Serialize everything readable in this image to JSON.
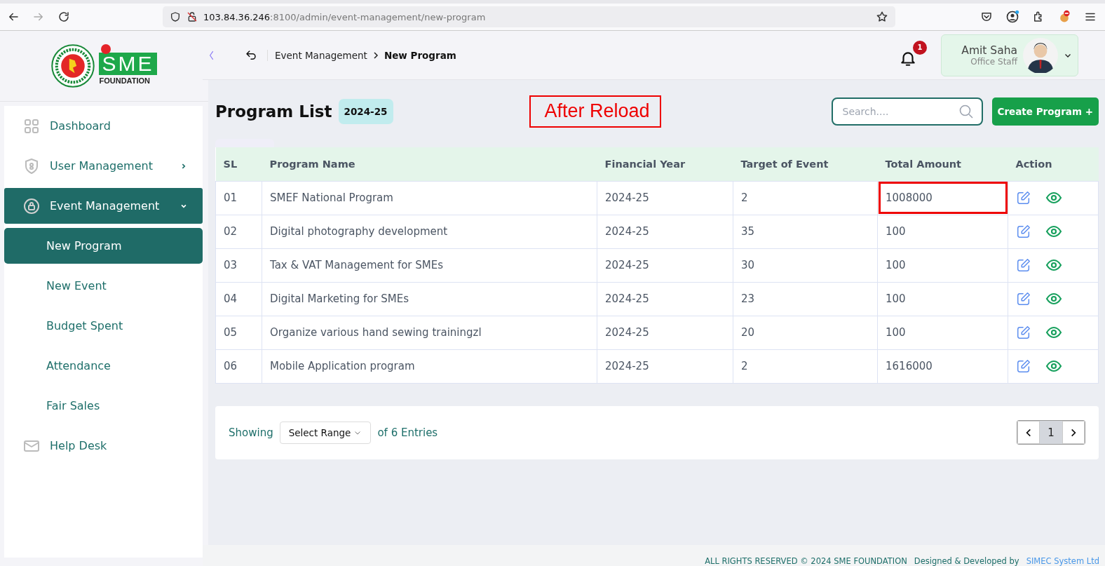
{
  "browser": {
    "url_host": "103.84.36.246",
    "url_rest": ":8100/admin/event-management/new-program"
  },
  "logo": {
    "wordmark": "SME",
    "subtitle": "FOUNDATION"
  },
  "header": {
    "breadcrumb": [
      {
        "label": "Event Management",
        "current": false
      },
      {
        "label": "New Program",
        "current": true
      }
    ],
    "notification_count": "1",
    "user": {
      "name": "Amit Saha",
      "role": "Office Staff"
    }
  },
  "sidebar": {
    "items": [
      {
        "label": "Dashboard",
        "selected": false
      },
      {
        "label": "User Management",
        "selected": false,
        "expanded": false
      },
      {
        "label": "Event Management",
        "selected": true,
        "expanded": true,
        "children": [
          {
            "label": "New Program",
            "selected": true
          },
          {
            "label": "New Event",
            "selected": false
          },
          {
            "label": "Budget Spent",
            "selected": false
          },
          {
            "label": "Attendance",
            "selected": false
          },
          {
            "label": "Fair Sales",
            "selected": false
          }
        ]
      },
      {
        "label": "Help Desk",
        "selected": false
      }
    ]
  },
  "page": {
    "title": "Program List",
    "year_badge": "2024-25",
    "annotation": "After Reload",
    "search": {
      "placeholder": "Search...."
    },
    "create_button": "Create Program +"
  },
  "table": {
    "columns": [
      "SL",
      "Program Name",
      "Financial Year",
      "Target of Event",
      "Total Amount",
      "Action"
    ],
    "rows": [
      {
        "sl": "01",
        "name": "SMEF National Program",
        "year": "2024-25",
        "target": "2",
        "amount": "1008000",
        "highlighted": true
      },
      {
        "sl": "02",
        "name": "Digital photography development",
        "year": "2024-25",
        "target": "35",
        "amount": "100",
        "highlighted": false
      },
      {
        "sl": "03",
        "name": "Tax & VAT Management for SMEs",
        "year": "2024-25",
        "target": "30",
        "amount": "100",
        "highlighted": false
      },
      {
        "sl": "04",
        "name": "Digital Marketing for SMEs",
        "year": "2024-25",
        "target": "23",
        "amount": "100",
        "highlighted": false
      },
      {
        "sl": "05",
        "name": "Organize various hand sewing trainingzl",
        "year": "2024-25",
        "target": "20",
        "amount": "100",
        "highlighted": false
      },
      {
        "sl": "06",
        "name": "Mobile Application program",
        "year": "2024-25",
        "target": "2",
        "amount": "1616000",
        "highlighted": false
      }
    ]
  },
  "pagination": {
    "showing": "Showing",
    "range_select": "Select Range",
    "entries": "of 6 Entries",
    "pages": [
      {
        "label": "1",
        "selected": true
      }
    ]
  },
  "footer": {
    "rights": "ALL RIGHTS RESERVED © 2024 SME FOUNDATION",
    "designed": "Designed & Developed by",
    "developer": "SIMEC System Ltd"
  }
}
